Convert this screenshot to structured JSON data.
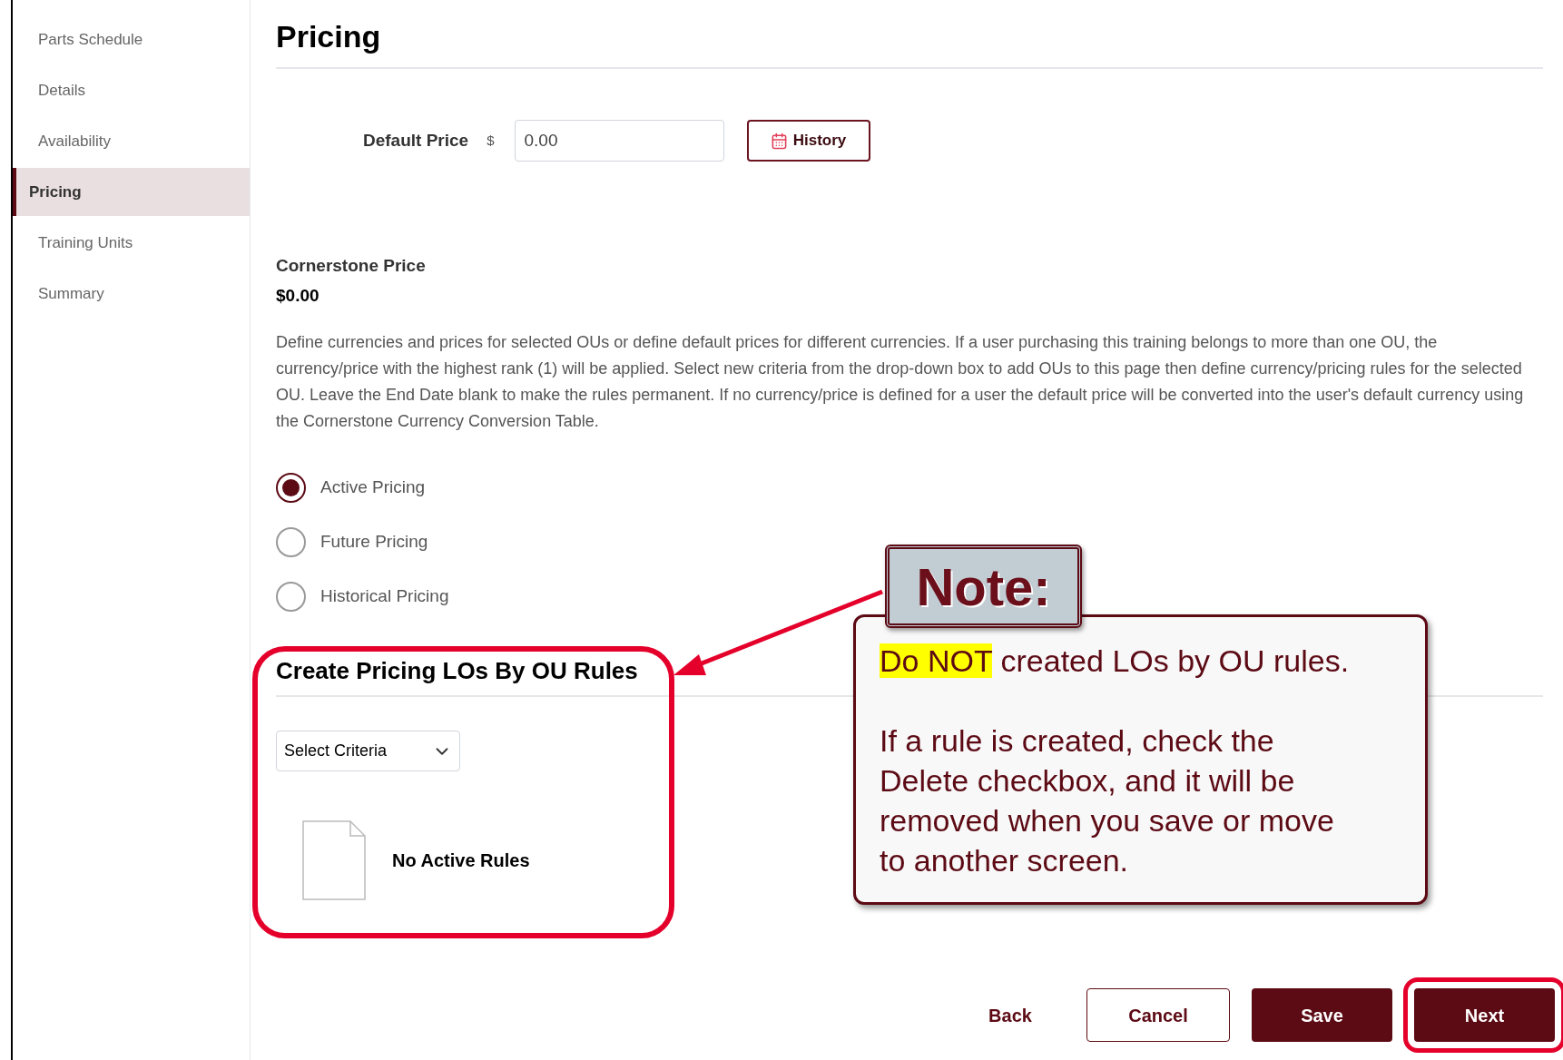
{
  "sidebar": {
    "items": [
      {
        "label": "Parts Schedule",
        "selected": false
      },
      {
        "label": "Details",
        "selected": false
      },
      {
        "label": "Availability",
        "selected": false
      },
      {
        "label": "Pricing",
        "selected": true
      },
      {
        "label": "Training Units",
        "selected": false
      },
      {
        "label": "Summary",
        "selected": false
      }
    ]
  },
  "page": {
    "title": "Pricing"
  },
  "default_price": {
    "label": "Default Price",
    "currency": "$",
    "value": "0.00",
    "history_button": "History"
  },
  "cornerstone_price": {
    "label": "Cornerstone Price",
    "value": "$0.00"
  },
  "description": "Define currencies and prices for selected OUs or define default prices for different currencies. If a user purchasing this training belongs to more than one OU, the currency/price with the highest rank (1) will be applied. Select new criteria from the drop-down box to add OUs to this page then define currency/pricing rules for the selected OU. Leave the End Date blank to make the rules permanent. If no currency/price is defined for a user the default price will be converted into the user's default currency using the Cornerstone Currency Conversion Table.",
  "pricing_options": [
    {
      "label": "Active Pricing",
      "selected": true
    },
    {
      "label": "Future Pricing",
      "selected": false
    },
    {
      "label": "Historical Pricing",
      "selected": false
    }
  ],
  "rules_section": {
    "title": "Create Pricing LOs By OU Rules",
    "select": {
      "value": "Select Criteria"
    },
    "empty_message": "No Active Rules"
  },
  "footer_buttons": [
    {
      "label": "Back",
      "kind": "link",
      "highlighted": false
    },
    {
      "label": "Cancel",
      "kind": "outline",
      "highlighted": false
    },
    {
      "label": "Save",
      "kind": "primary",
      "highlighted": false
    },
    {
      "label": "Next",
      "kind": "primary",
      "highlighted": true
    }
  ],
  "annotation": {
    "heading": "Note:",
    "paragraphs": [
      {
        "highlight": "Do NOT",
        "text": "created LOs by OU rules."
      },
      {
        "text": "If a rule is created, check the\nDelete checkbox, and it will be\nremoved when you save or move\nto another screen."
      }
    ]
  }
}
